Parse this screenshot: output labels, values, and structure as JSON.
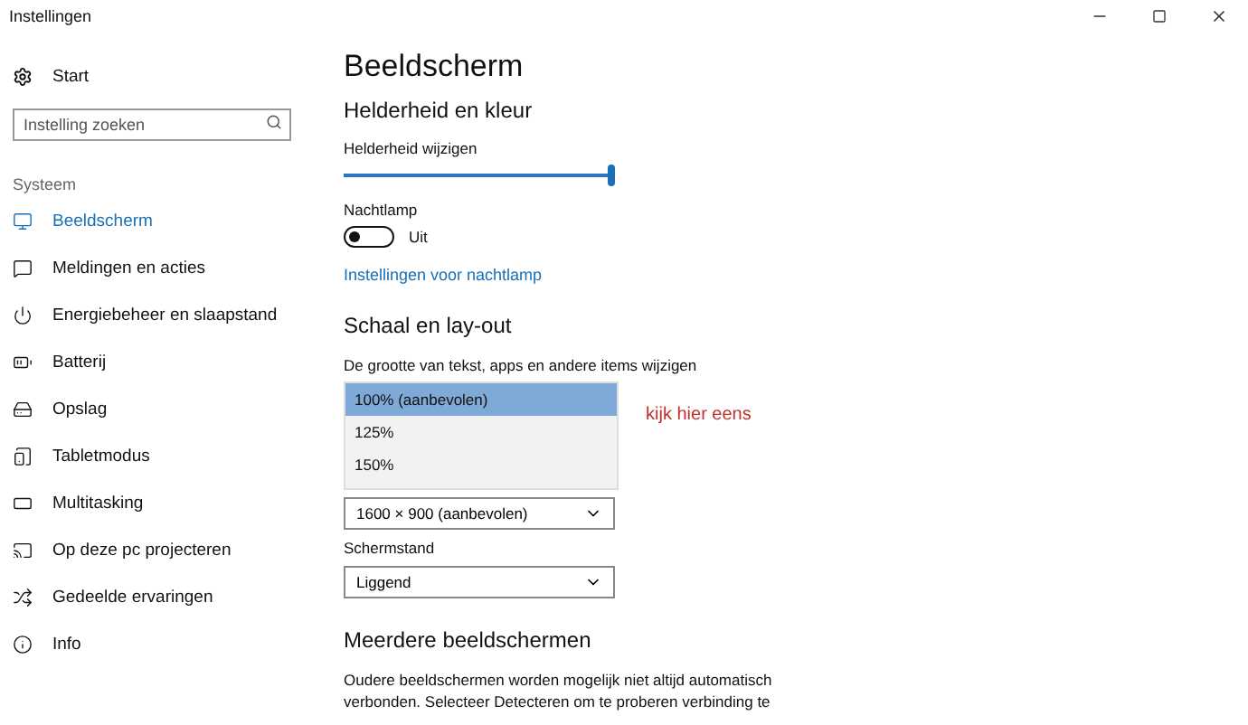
{
  "window": {
    "title": "Instellingen"
  },
  "sidebar": {
    "home": "Start",
    "search": {
      "placeholder": "Instelling zoeken"
    },
    "section": "Systeem",
    "items": [
      {
        "label": "Beeldscherm",
        "selected": true
      },
      {
        "label": "Meldingen en acties",
        "selected": false
      },
      {
        "label": "Energiebeheer en slaapstand",
        "selected": false
      },
      {
        "label": "Batterij",
        "selected": false
      },
      {
        "label": "Opslag",
        "selected": false
      },
      {
        "label": "Tabletmodus",
        "selected": false
      },
      {
        "label": "Multitasking",
        "selected": false
      },
      {
        "label": "Op deze pc projecteren",
        "selected": false
      },
      {
        "label": "Gedeelde ervaringen",
        "selected": false
      },
      {
        "label": "Info",
        "selected": false
      }
    ]
  },
  "page": {
    "title": "Beeldscherm",
    "brightness_section": "Helderheid en kleur",
    "brightness": {
      "label": "Helderheid wijzigen",
      "level": 1
    },
    "night_light": {
      "label": "Nachtlamp",
      "on": false,
      "state": "Uit"
    },
    "night_link": "Instellingen voor nachtlamp",
    "scale_section": "Schaal en lay-out",
    "scale_label": "De grootte van tekst, apps en andere items wijzigen",
    "scale_options": [
      {
        "label": "100% (aanbevolen)",
        "selected": true
      },
      {
        "label": "125%",
        "selected": false
      },
      {
        "label": "150%",
        "selected": false
      }
    ],
    "annotation": "kijk hier eens",
    "resolution": "1600 × 900 (aanbevolen)",
    "orientation_label": "Schermstand",
    "orientation": "Liggend",
    "multi_section": "Meerdere beeldschermen",
    "multi_text": "Oudere beeldschermen worden mogelijk niet altijd automatisch verbonden. Selecteer Detecteren om te proberen verbinding te"
  }
}
